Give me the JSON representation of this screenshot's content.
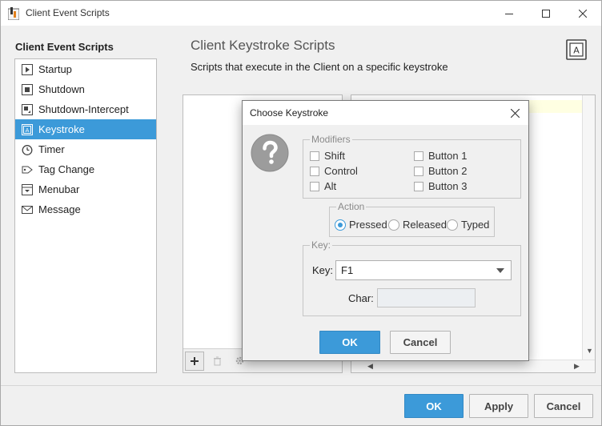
{
  "window": {
    "title": "Client Event Scripts"
  },
  "sidebar": {
    "header": "Client Event Scripts",
    "items": [
      {
        "label": "Startup",
        "icon": "startup-icon"
      },
      {
        "label": "Shutdown",
        "icon": "shutdown-icon"
      },
      {
        "label": "Shutdown-Intercept",
        "icon": "shutdown-intercept-icon"
      },
      {
        "label": "Keystroke",
        "icon": "keystroke-icon",
        "selected": true
      },
      {
        "label": "Timer",
        "icon": "timer-icon"
      },
      {
        "label": "Tag Change",
        "icon": "tag-change-icon"
      },
      {
        "label": "Menubar",
        "icon": "menubar-icon"
      },
      {
        "label": "Message",
        "icon": "message-icon"
      }
    ]
  },
  "main": {
    "title": "Client Keystroke Scripts",
    "subtitle": "Scripts that execute in the Client on a specific keystroke",
    "badge_letter": "A"
  },
  "dialog": {
    "title": "Choose Keystroke",
    "modifiers": {
      "legend": "Modifiers",
      "items": [
        "Shift",
        "Control",
        "Alt",
        "Button 1",
        "Button 2",
        "Button 3"
      ]
    },
    "action": {
      "legend": "Action",
      "options": [
        "Pressed",
        "Released",
        "Typed"
      ],
      "selected": "Pressed"
    },
    "key_group": {
      "legend": "Key:",
      "key_label": "Key:",
      "key_value": "F1",
      "char_label": "Char:",
      "char_value": ""
    },
    "ok_label": "OK",
    "cancel_label": "Cancel"
  },
  "footer": {
    "ok_label": "OK",
    "apply_label": "Apply",
    "cancel_label": "Cancel"
  },
  "colors": {
    "accent": "#3c9ad9",
    "selection": "#3c9ad9",
    "editor_highlight": "#ffffe2"
  }
}
